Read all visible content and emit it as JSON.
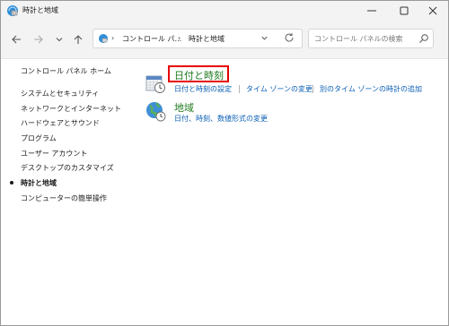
{
  "window": {
    "title": "時計と地域",
    "controls": {
      "minimize_icon": "minimize-icon",
      "maximize_icon": "maximize-icon",
      "close_icon": "close-icon"
    }
  },
  "nav": {
    "back_icon": "arrow-left-icon",
    "forward_icon": "arrow-right-icon",
    "recent_icon": "chevron-down-icon",
    "up_icon": "arrow-up-icon"
  },
  "address": {
    "crumbs": [
      "コントロール パ...",
      "時計と地域"
    ],
    "separator": "›",
    "dropdown_icon": "chevron-down-icon",
    "refresh_icon": "refresh-icon"
  },
  "search": {
    "placeholder": "コントロール パネルの検索",
    "value": ""
  },
  "sidebar": {
    "home": "コントロール パネル ホーム",
    "items": [
      {
        "label": "システムとセキュリティ",
        "current": false
      },
      {
        "label": "ネットワークとインターネット",
        "current": false
      },
      {
        "label": "ハードウェアとサウンド",
        "current": false
      },
      {
        "label": "プログラム",
        "current": false
      },
      {
        "label": "ユーザー アカウント",
        "current": false
      },
      {
        "label": "デスクトップのカスタマイズ",
        "current": false
      },
      {
        "label": "時計と地域",
        "current": true
      },
      {
        "label": "コンピューターの簡単操作",
        "current": false
      }
    ]
  },
  "categories": [
    {
      "title": "日付と時刻",
      "icon": "calendar-clock-icon",
      "highlighted": true,
      "highlight_color": "#e60000",
      "tasks": [
        "日付と時刻の設定",
        "タイム ゾーンの変更",
        "別のタイム ゾーンの時計の追加"
      ]
    },
    {
      "title": "地域",
      "icon": "globe-clock-icon",
      "highlighted": false,
      "tasks": [
        "日付、時刻、数値形式の変更"
      ]
    }
  ],
  "colors": {
    "category_title": "#1e7a1e",
    "task_link": "#0a5fb4",
    "highlight": "#e60000"
  }
}
